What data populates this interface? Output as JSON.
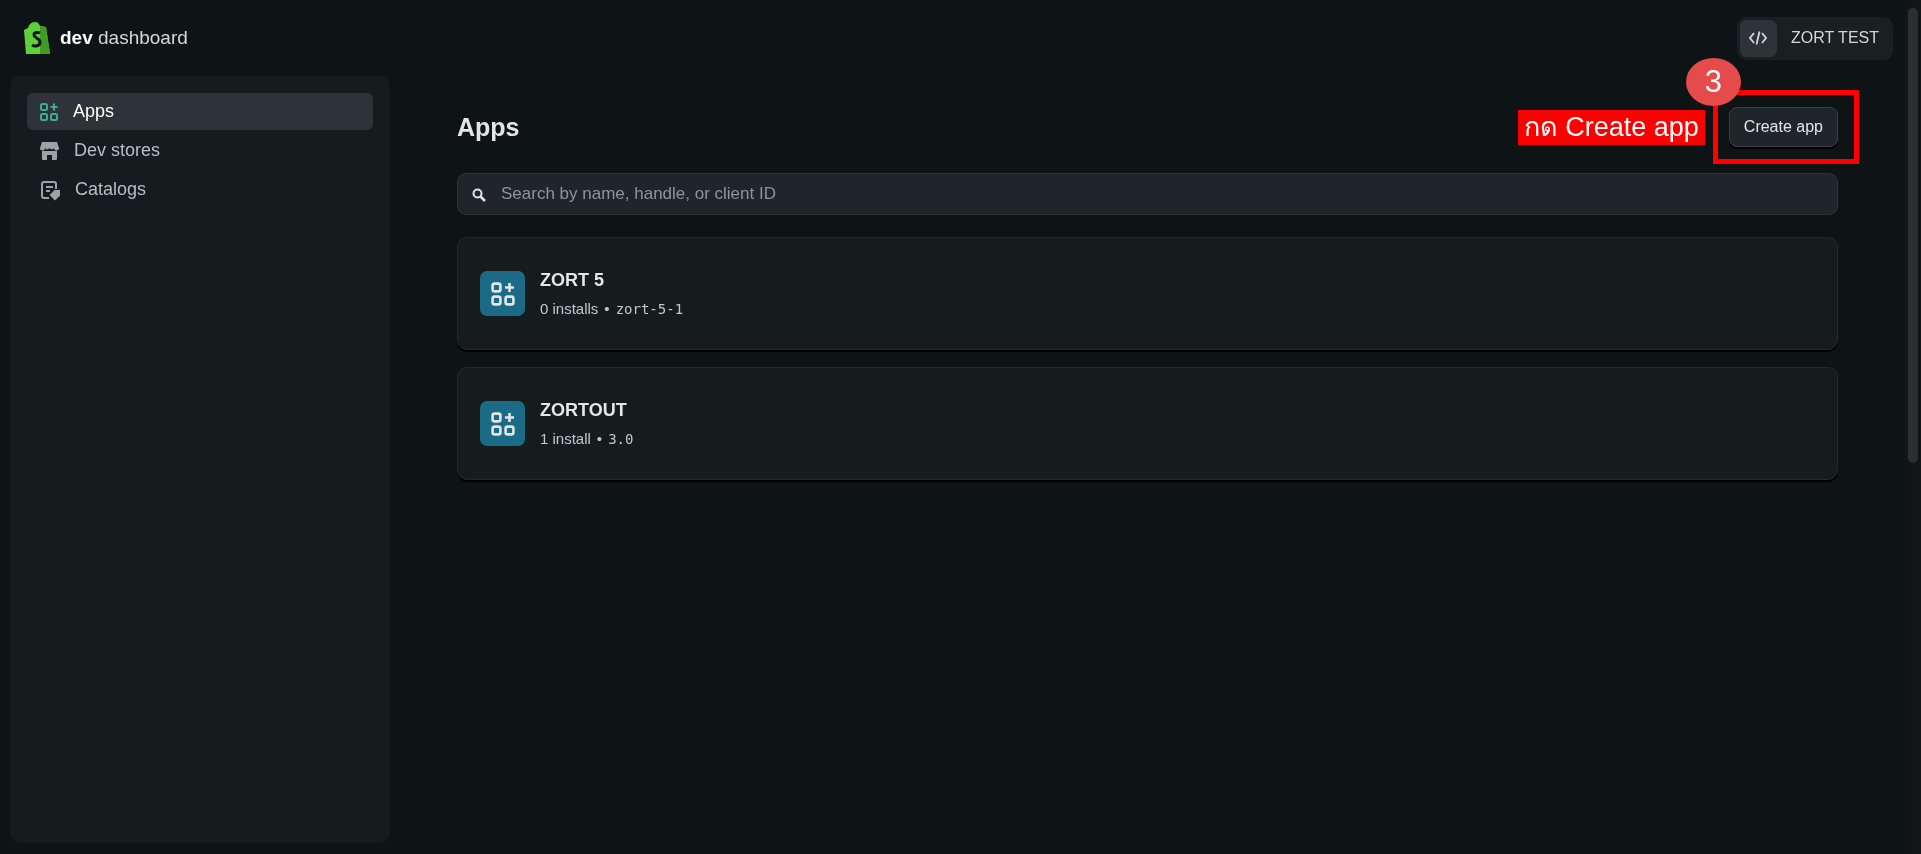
{
  "brand": {
    "bold": "dev",
    "rest": "dashboard"
  },
  "account": {
    "name": "ZORT TEST"
  },
  "sidebar": {
    "items": [
      {
        "label": "Apps",
        "selected": true
      },
      {
        "label": "Dev stores",
        "selected": false
      },
      {
        "label": "Catalogs",
        "selected": false
      }
    ]
  },
  "page": {
    "title": "Apps",
    "annotation": {
      "step": "3",
      "label": "กด Create app"
    },
    "create_button": "Create app"
  },
  "search": {
    "placeholder": "Search by name, handle, or client ID"
  },
  "apps": [
    {
      "name": "ZORT 5",
      "installs": "0 installs",
      "separator": "•",
      "handle": "zort-5-1"
    },
    {
      "name": "ZORTOUT",
      "installs": "1 install",
      "separator": "•",
      "handle": "3.0"
    }
  ]
}
